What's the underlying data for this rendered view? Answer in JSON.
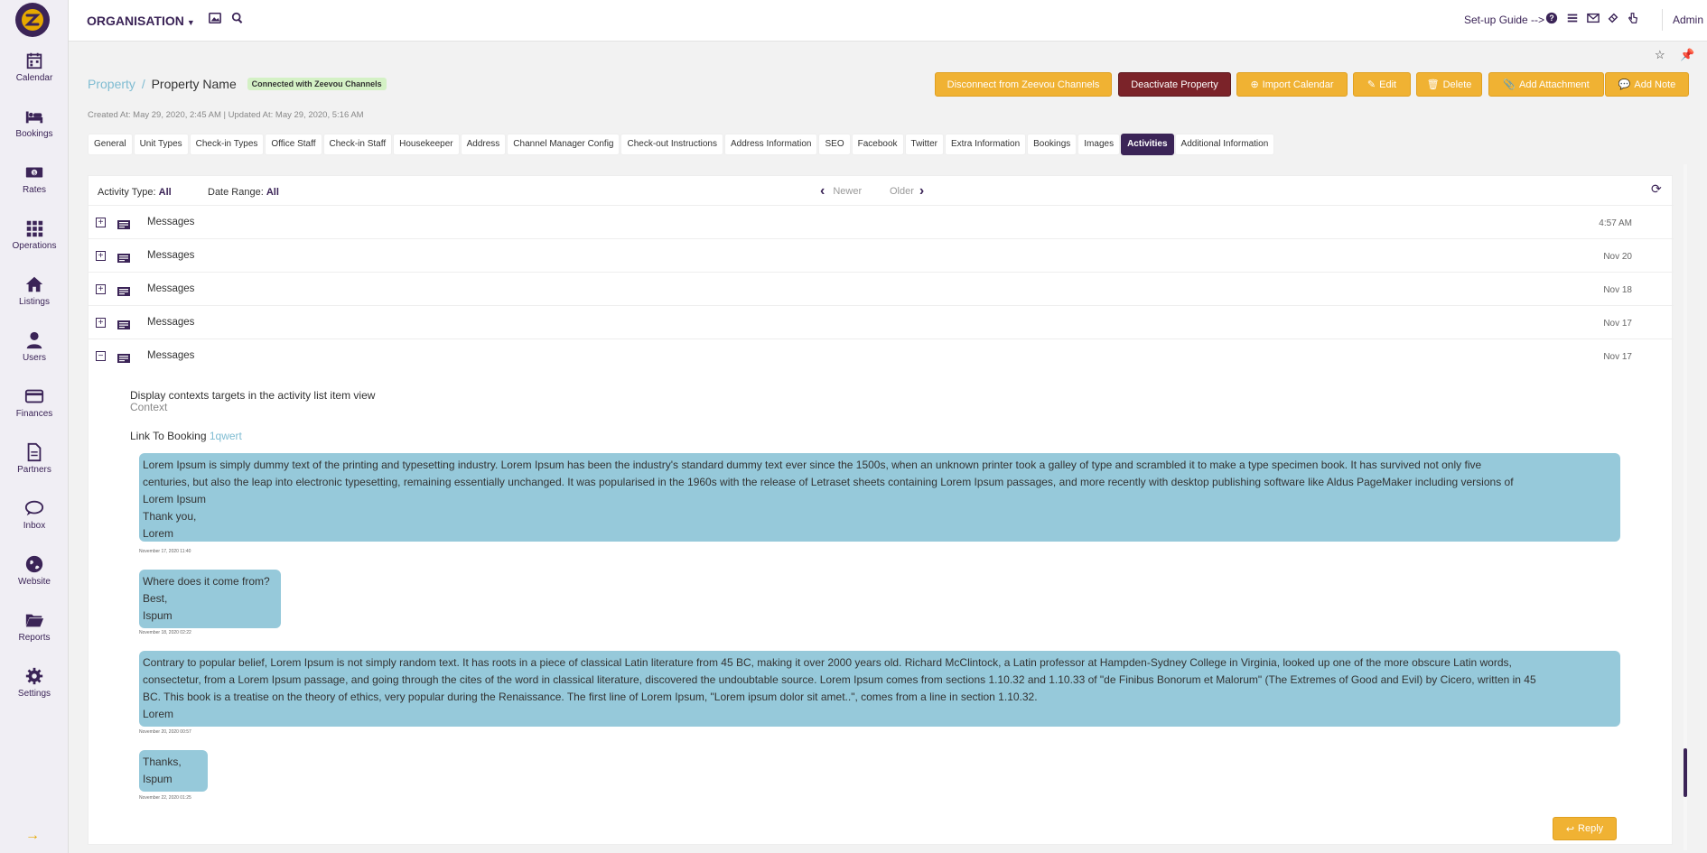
{
  "sidebar": {
    "items": [
      {
        "label": "Calendar",
        "icon": "calendar-icon"
      },
      {
        "label": "Bookings",
        "icon": "bed-icon"
      },
      {
        "label": "Rates",
        "icon": "money-icon"
      },
      {
        "label": "Operations",
        "icon": "grid-icon"
      },
      {
        "label": "Listings",
        "icon": "home-icon"
      },
      {
        "label": "Users",
        "icon": "user-icon"
      },
      {
        "label": "Finances",
        "icon": "credit-card-icon"
      },
      {
        "label": "Partners",
        "icon": "document-icon"
      },
      {
        "label": "Inbox",
        "icon": "chat-icon"
      },
      {
        "label": "Website",
        "icon": "globe-icon"
      },
      {
        "label": "Reports",
        "icon": "folder-icon"
      },
      {
        "label": "Settings",
        "icon": "gear-icon"
      }
    ],
    "collapse_icon": "arrow-right-icon"
  },
  "topbar": {
    "org_label": "ORGANISATION",
    "setup_guide": "Set-up Guide -->",
    "user": "Admin"
  },
  "header": {
    "breadcrumb_link": "Property",
    "breadcrumb_sep": "/",
    "property_name": "Property Name",
    "connected_badge": "Connected with Zeevou Channels",
    "meta": "Created At: May 29, 2020, 2:45 AM  |  Updated At: May 29, 2020, 5:16 AM"
  },
  "actions": {
    "disconnect": "Disconnect from Zeevou Channels",
    "deactivate": "Deactivate Property",
    "import_calendar": "Import Calendar",
    "edit": "Edit",
    "delete": "Delete",
    "add_attachment": "Add Attachment",
    "add_note": "Add Note"
  },
  "tabs": [
    "General",
    "Unit Types",
    "Check-in Types",
    "Office Staff",
    "Check-in Staff",
    "Housekeeper",
    "Address",
    "Channel Manager Config",
    "Check-out Instructions",
    "Address Information",
    "SEO",
    "Facebook",
    "Twitter",
    "Extra Information",
    "Bookings",
    "Images",
    "Activities",
    "Additional Information"
  ],
  "active_tab": "Activities",
  "filters": {
    "activity_type_label": "Activity Type:",
    "activity_type_value": "All",
    "date_range_label": "Date Range:",
    "date_range_value": "All",
    "newer": "Newer",
    "older": "Older"
  },
  "activities": [
    {
      "title": "Messages",
      "time": "4:57 AM",
      "expanded": false
    },
    {
      "title": "Messages",
      "time": "Nov 20",
      "expanded": false
    },
    {
      "title": "Messages",
      "time": "Nov 18",
      "expanded": false
    },
    {
      "title": "Messages",
      "time": "Nov 17",
      "expanded": false
    },
    {
      "title": "Messages",
      "time": "Nov 17",
      "expanded": true
    }
  ],
  "detail": {
    "context_line": "Display contexts targets in the activity list item view",
    "context_label": "Context",
    "link_label": "Link To Booking",
    "link_value": "1qwert",
    "messages": [
      {
        "lines": [
          "Lorem Ipsum is simply dummy text of the printing and typesetting industry. Lorem Ipsum has been the industry's standard dummy text ever since the 1500s, when an unknown printer took a galley of type and scrambled it to make a type specimen book. It has survived not only five",
          "centuries, but also the leap into electronic typesetting, remaining essentially unchanged. It was popularised in the 1960s with the release of Letraset sheets containing Lorem Ipsum passages, and more recently with desktop publishing software like Aldus PageMaker including versions of",
          "Lorem Ipsum",
          "Thank you,",
          "Lorem"
        ],
        "date": "November 17, 2020 11:40"
      },
      {
        "lines": [
          "Where does it come from?",
          "Best,",
          "Ispum"
        ],
        "date": "November 18, 2020 02:22"
      },
      {
        "lines": [
          "Contrary to popular belief, Lorem Ipsum is not simply random text. It has roots in a piece of classical Latin literature from 45 BC, making it over 2000 years old. Richard McClintock, a Latin professor at Hampden-Sydney College in Virginia, looked up one of the more obscure Latin words,",
          "consectetur, from a Lorem Ipsum passage, and going through the cites of the word in classical literature, discovered the undoubtable source. Lorem Ipsum comes from sections 1.10.32 and 1.10.33 of \"de Finibus Bonorum et Malorum\" (The Extremes of Good and Evil) by Cicero, written in 45",
          "BC. This book is a treatise on the theory of ethics, very popular during the Renaissance. The first line of Lorem Ipsum, \"Lorem ipsum dolor sit amet..\", comes from a line in section 1.10.32.",
          "Lorem"
        ],
        "date": "November 20, 2020 00:57"
      },
      {
        "lines": [
          "Thanks,",
          "Ispum"
        ],
        "date": "November 22, 2020 01:25"
      }
    ],
    "reply": "Reply"
  },
  "colors": {
    "brand": "#3b2457",
    "accent": "#f0b233",
    "danger": "#7b2329",
    "bubble": "#96c9da",
    "link": "#7fbcd2"
  }
}
